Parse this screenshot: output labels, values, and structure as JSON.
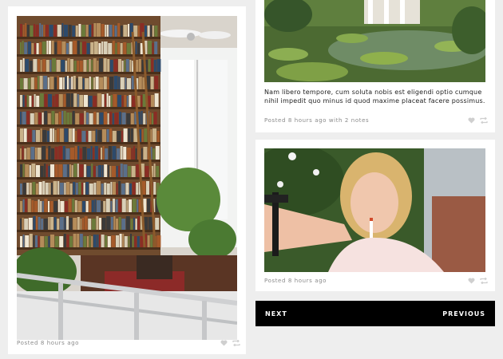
{
  "posts": [
    {
      "image_alt": "Library with tall bookshelves, ladder and plants",
      "meta": "Posted 8 hours ago"
    },
    {
      "image_alt": "Garden pond with water lilies",
      "caption": "Nam libero tempore, cum soluta nobis est eligendi optio cumque nihil impedit quo minus id quod maxime placeat facere possimus.",
      "meta": "Posted 8 hours ago with 2 notes"
    },
    {
      "image_alt": "Woman with cigarette aiming a gun",
      "meta": "Posted 8 hours ago"
    }
  ],
  "nav": {
    "next_label": "NEXT",
    "previous_label": "PREVIOUS"
  },
  "colors": {
    "background": "#eeeeee",
    "card": "#ffffff",
    "nav_bg": "#000000",
    "meta_text": "#8a8a8a",
    "icon": "#cfcfcf"
  },
  "icons": [
    "heart-icon",
    "reblog-icon"
  ]
}
